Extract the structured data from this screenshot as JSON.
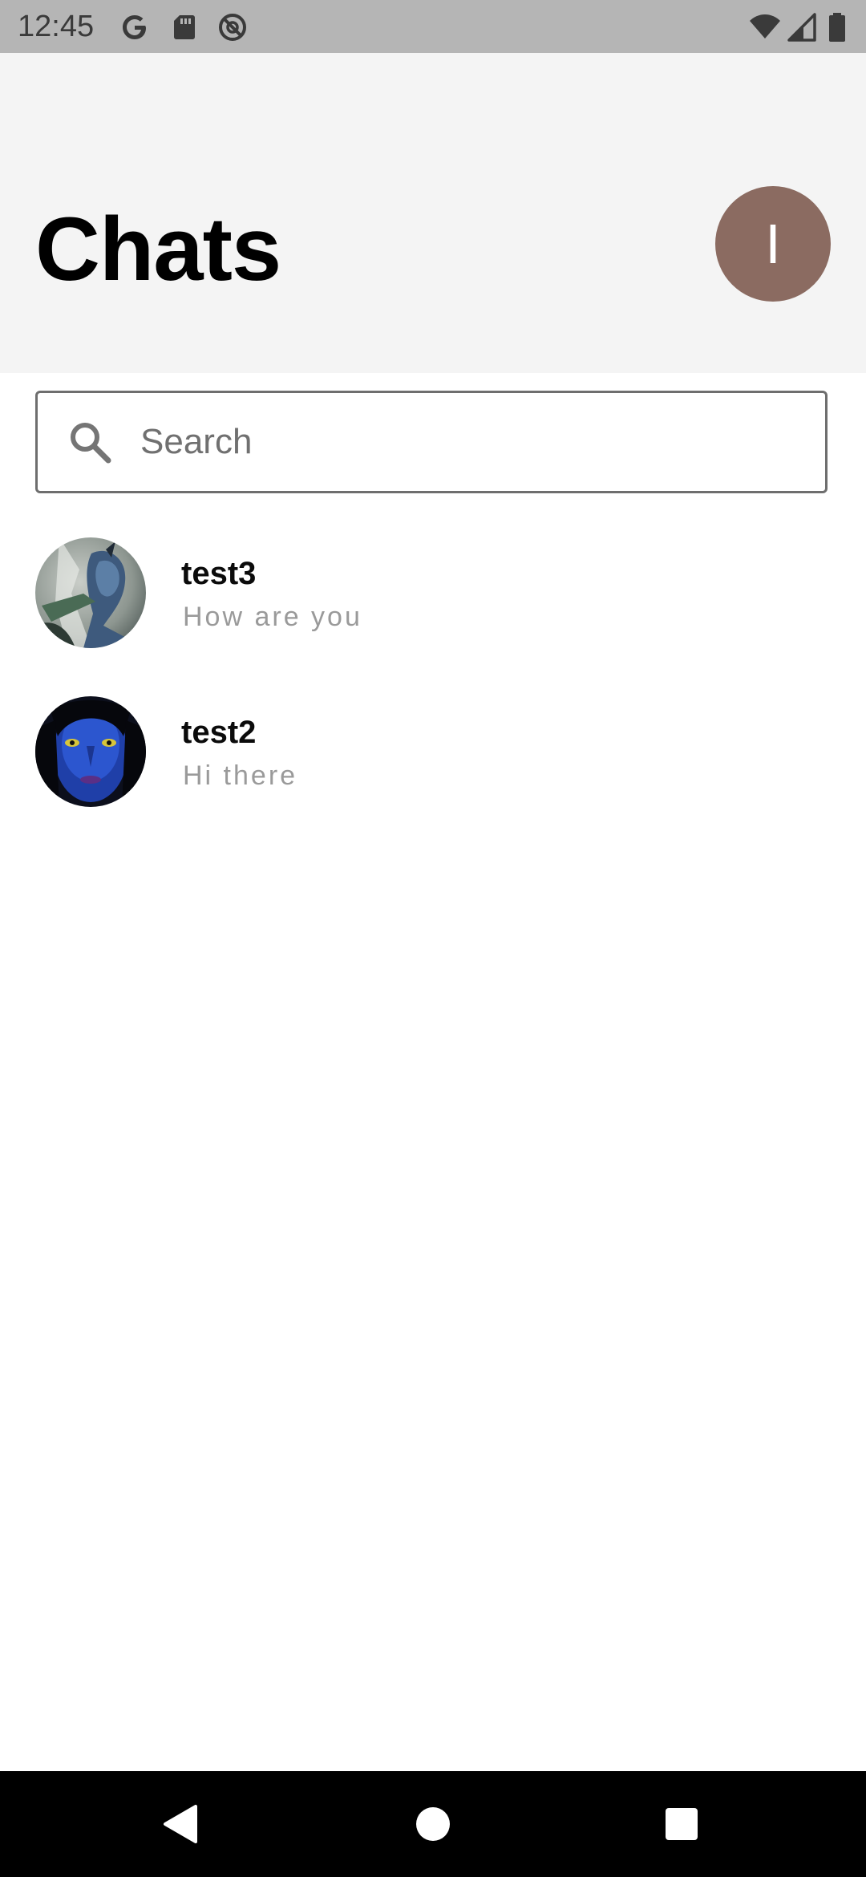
{
  "status_bar": {
    "time": "12:45",
    "left_icons": [
      "google-icon",
      "sd-card-icon",
      "do-not-disturb-icon"
    ],
    "right_icons": [
      "wifi-icon",
      "cell-signal-icon",
      "battery-icon"
    ]
  },
  "header": {
    "title": "Chats",
    "profile_initial": "I",
    "profile_color": "#8b6b61"
  },
  "search": {
    "placeholder": "Search",
    "value": ""
  },
  "chats": [
    {
      "name": "test3",
      "preview": "How are you",
      "avatar": "avatar-test3"
    },
    {
      "name": "test2",
      "preview": "Hi there",
      "avatar": "avatar-test2"
    }
  ],
  "nav_bar": {
    "buttons": [
      "back-icon",
      "home-icon",
      "recents-icon"
    ]
  }
}
